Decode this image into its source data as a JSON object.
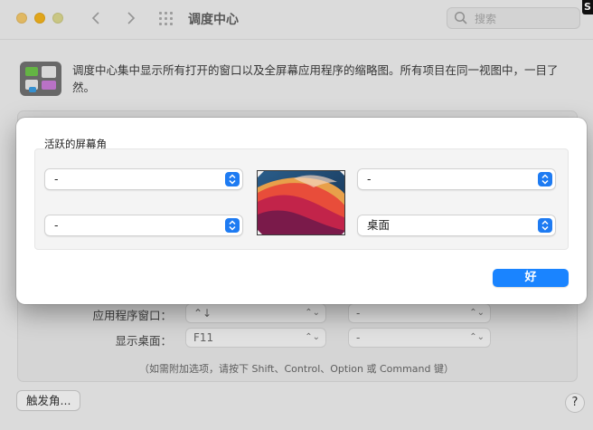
{
  "window": {
    "title": "调度中心",
    "search_placeholder": "搜索",
    "corner_glyph": "S"
  },
  "description": "调度中心集中显示所有打开的窗口以及全屏幕应用程序的缩略图。所有项目在同一视图中，一目了然。",
  "background_settings": {
    "rows": [
      {
        "label": "应用程序窗口：",
        "primary": "⌃↓",
        "secondary": "-"
      },
      {
        "label": "显示桌面：",
        "primary": "F11",
        "secondary": "-"
      }
    ],
    "hint": "（如需附加选项，请按下 Shift、Control、Option 或 Command 键）",
    "hot_corners_button": "触发角...",
    "help_button": "?"
  },
  "dialog": {
    "title": "活跃的屏幕角",
    "top_left": "-",
    "top_right": "-",
    "bottom_left": "-",
    "bottom_right": "桌面",
    "ok_label": "好"
  },
  "colors": {
    "accent": "#1a84ff"
  }
}
